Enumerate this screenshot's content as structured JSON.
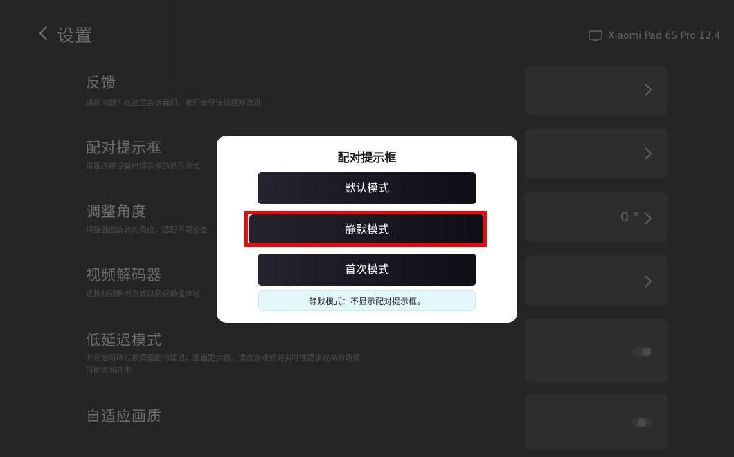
{
  "header": {
    "title": "设置",
    "device_name": "Xiaomi Pad 6S Pro 12.4"
  },
  "settings": [
    {
      "title": "反馈",
      "description": "遇到问题？在这里告诉我们，我们会尽快处理并改进",
      "value": ""
    },
    {
      "title": "配对提示框",
      "description": "设置连接设备时提示框的显示方式",
      "value": ""
    },
    {
      "title": "调整角度",
      "description": "调整画面旋转的角度，适配不同设备",
      "value": "0 °"
    },
    {
      "title": "视频解码器",
      "description": "选择视频解码方式以获得最佳体验",
      "value": ""
    },
    {
      "title": "低延迟模式",
      "description": "开启后可降低投屏画面的延迟，画面更流畅，适合游戏或对实时性要求较高的场景",
      "description2": "可能增加耗电",
      "value": ""
    },
    {
      "title": "自适应画质",
      "description": "",
      "value": ""
    }
  ],
  "dialog": {
    "title": "配对提示框",
    "buttons": {
      "default": "默认模式",
      "silent": "静默模式",
      "first": "首次模式"
    },
    "hint": "静默模式：不显示配对提示框。"
  },
  "colors": {
    "highlight": "#ff0000",
    "button_gradient_start": "#26232f",
    "button_gradient_end": "#0f0d16",
    "hint_background": "#e3f8fb"
  }
}
